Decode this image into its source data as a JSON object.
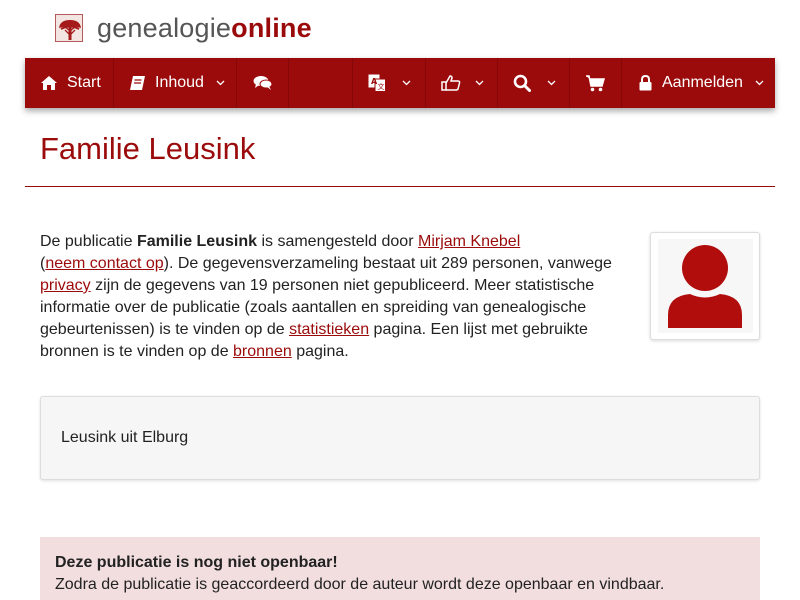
{
  "brand": {
    "part1": "genealogie",
    "part2": "online"
  },
  "nav": {
    "start_label": "Start",
    "content_label": "Inhoud",
    "login_label": "Aanmelden"
  },
  "page_title": "Familie Leusink",
  "intro": {
    "t1": "De publicatie ",
    "pub_name": "Familie Leusink",
    "t2": " is samengesteld door ",
    "author_link": "Mirjam Knebel",
    "t3": "(",
    "contact_link": "neem contact op",
    "t4": "). De gegevensverzameling bestaat uit 289 personen, vanwege ",
    "privacy_link": "privacy",
    "t5": " zijn de gegevens van 19 personen niet gepubliceerd. Meer statistische informatie over de publicatie (zoals aantallen en spreiding van genealogische gebeurtenissen) is te vinden op de ",
    "stats_link": "statistieken",
    "t6": " pagina. Een lijst met gebruikte bronnen is te vinden op de ",
    "sources_link": "bronnen",
    "t7": " pagina."
  },
  "description": "Leusink uit Elburg",
  "alert": {
    "title": "Deze publicatie is nog niet openbaar!",
    "text": "Zodra de publicatie is geaccordeerd door de auteur wordt deze openbaar en vindbaar."
  },
  "colors": {
    "brand": "#9b0b0b",
    "alert_bg": "#f2dede"
  },
  "icons": [
    "home-icon",
    "book-icon",
    "comments-icon",
    "translate-icon",
    "thumbs-up-icon",
    "search-icon",
    "cart-icon",
    "lock-icon",
    "user-icon"
  ]
}
